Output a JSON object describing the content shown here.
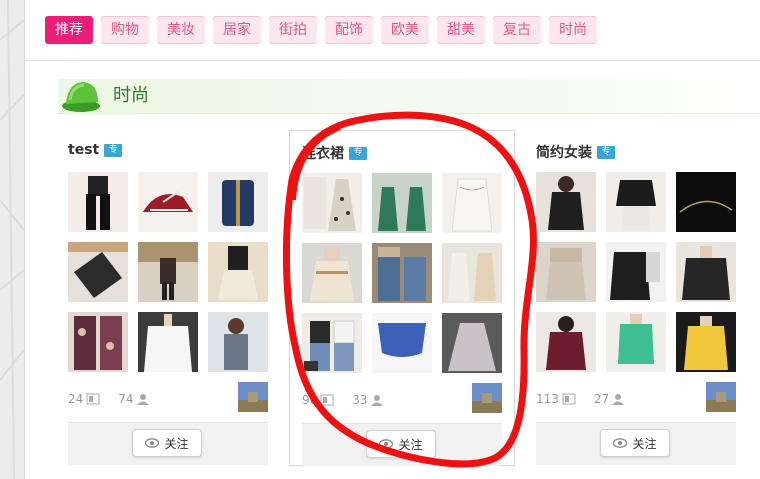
{
  "tabs": [
    {
      "label": "推荐",
      "active": true
    },
    {
      "label": "购物",
      "active": false
    },
    {
      "label": "美妆",
      "active": false
    },
    {
      "label": "居家",
      "active": false
    },
    {
      "label": "街拍",
      "active": false
    },
    {
      "label": "配饰",
      "active": false
    },
    {
      "label": "欧美",
      "active": false
    },
    {
      "label": "甜美",
      "active": false
    },
    {
      "label": "复古",
      "active": false
    },
    {
      "label": "时尚",
      "active": false
    }
  ],
  "section": {
    "title": "时尚",
    "icon": "green-cap-icon"
  },
  "boards": [
    {
      "title": "test",
      "badge": "专",
      "posts": "24",
      "followers": "74",
      "follow_label": "关注"
    },
    {
      "title": "连衣裙",
      "badge": "专",
      "posts": "96",
      "followers": "33",
      "follow_label": "关注"
    },
    {
      "title": "简约女装",
      "badge": "专",
      "posts": "113",
      "followers": "27",
      "follow_label": "关注"
    }
  ],
  "colors": {
    "accent": "#e91e78",
    "tab_bg": "#fde7ef",
    "tab_text": "#e0588c",
    "section_text": "#2f7d2a",
    "badge": "#3ba5d8",
    "annotation": "#ee1111"
  }
}
